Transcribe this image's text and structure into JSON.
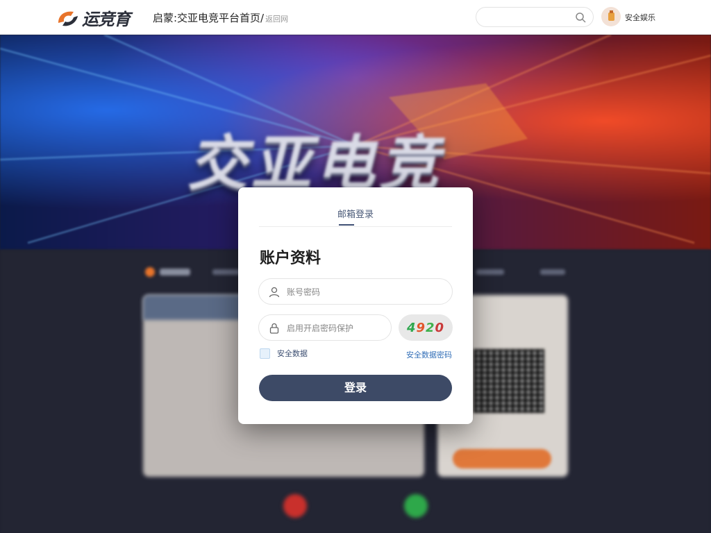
{
  "header": {
    "logo_text": "运竞育",
    "breadcrumb": "启蒙:交亚电竞平台首页/",
    "breadcrumb_sub": "返回网",
    "search_placeholder": "",
    "user_label": "安全娱乐"
  },
  "hero": {
    "title": "交亚电竞"
  },
  "modal": {
    "tab_label": "邮箱登录",
    "title": "账户资料",
    "account_placeholder": "账号密码",
    "password_placeholder": "启用开启密码保护",
    "captcha": [
      "4",
      "9",
      "2",
      "0"
    ],
    "remember_label": "安全数据",
    "forgot_label": "安全数据密码",
    "login_label": "登录"
  },
  "colors": {
    "brand_dark": "#3d4a66",
    "link": "#3470b8",
    "logo_orange": "#e8742b"
  }
}
